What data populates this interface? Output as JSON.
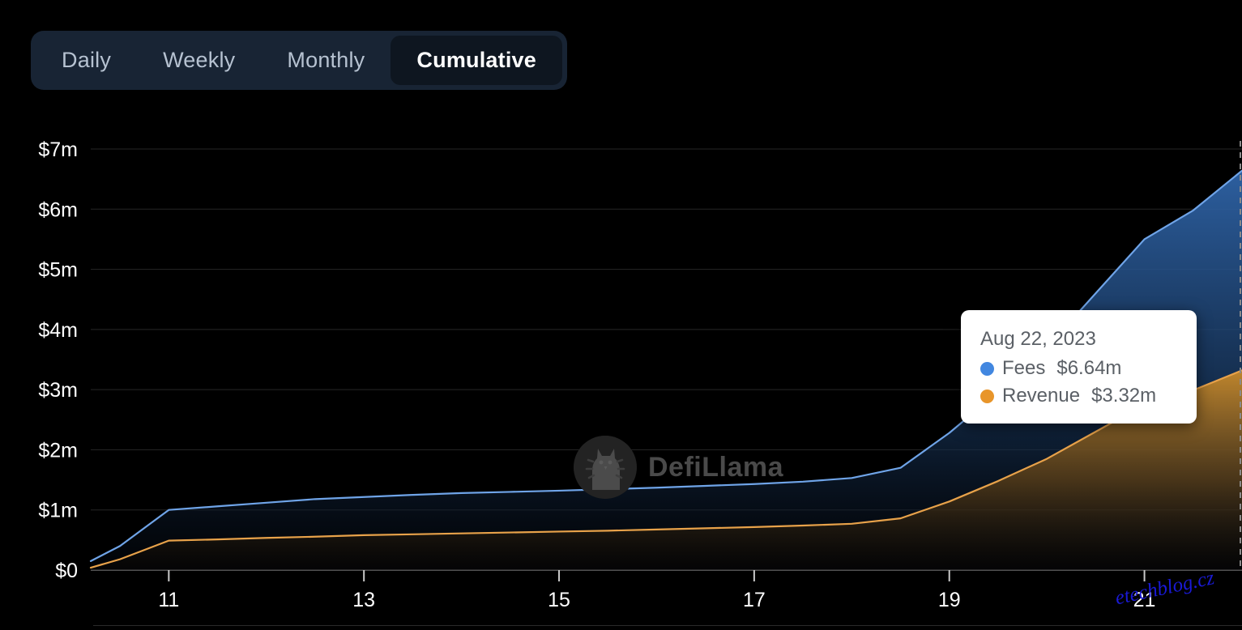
{
  "tabs": {
    "items": [
      {
        "label": "Daily",
        "active": false
      },
      {
        "label": "Weekly",
        "active": false
      },
      {
        "label": "Monthly",
        "active": false
      },
      {
        "label": "Cumulative",
        "active": true
      }
    ]
  },
  "watermark": {
    "brand": "DefiLlama",
    "site": "etechblog.cz"
  },
  "tooltip": {
    "date": "Aug 22, 2023",
    "rows": [
      {
        "name": "Fees",
        "value": "$6.64m",
        "color": "#4287e0"
      },
      {
        "name": "Revenue",
        "value": "$3.32m",
        "color": "#e8952a"
      }
    ]
  },
  "colors": {
    "background": "#000000",
    "tabbar": "#182434",
    "tab_active_bg": "#0e1620",
    "tab_text": "#b6c2d1",
    "tab_active_text": "#ffffff",
    "fees_line": "#6fa4e8",
    "fees_fill": "#2f64a8",
    "revenue_line": "#e8a24a",
    "revenue_fill": "#c98a2a",
    "grid": "#262626",
    "axis_text": "#ffffff",
    "crosshair": "#8a8a8a"
  },
  "chart_data": {
    "type": "area",
    "title": "",
    "subtitle": "",
    "xlabel": "",
    "ylabel": "",
    "grid": true,
    "legend_position": "tooltip",
    "ylim": [
      0,
      7000000
    ],
    "ytick_labels": [
      "$0",
      "$1m",
      "$2m",
      "$3m",
      "$4m",
      "$5m",
      "$6m",
      "$7m"
    ],
    "ytick_values": [
      0,
      1000000,
      2000000,
      3000000,
      4000000,
      5000000,
      6000000,
      7000000
    ],
    "xtick_labels": [
      "11",
      "13",
      "15",
      "17",
      "19",
      "21"
    ],
    "xtick_values": [
      11,
      13,
      15,
      17,
      19,
      21
    ],
    "xlim": [
      10.2,
      22.0
    ],
    "x": [
      10.2,
      10.5,
      11.0,
      11.5,
      12.0,
      12.5,
      13.0,
      13.5,
      14.0,
      14.5,
      15.0,
      15.5,
      16.0,
      16.5,
      17.0,
      17.5,
      18.0,
      18.5,
      19.0,
      19.5,
      20.0,
      20.5,
      21.0,
      21.5,
      22.0
    ],
    "series": [
      {
        "name": "Fees",
        "color": "#6fa4e8",
        "fill": "#2f64a8",
        "values": [
          150000,
          400000,
          1000000,
          1060000,
          1120000,
          1180000,
          1215000,
          1250000,
          1280000,
          1300000,
          1320000,
          1345000,
          1370000,
          1400000,
          1430000,
          1470000,
          1530000,
          1700000,
          2280000,
          2960000,
          3700000,
          4600000,
          5500000,
          5980000,
          6640000
        ]
      },
      {
        "name": "Revenue",
        "color": "#e8a24a",
        "fill": "#c98a2a",
        "values": [
          40000,
          180000,
          490000,
          510000,
          535000,
          555000,
          580000,
          595000,
          610000,
          625000,
          640000,
          655000,
          675000,
          695000,
          715000,
          740000,
          770000,
          860000,
          1140000,
          1480000,
          1850000,
          2300000,
          2750000,
          2990000,
          3320000
        ]
      }
    ],
    "highlight": {
      "x": 22.0,
      "date": "Aug 22, 2023",
      "fees": "$6.64m",
      "revenue": "$3.32m"
    }
  }
}
